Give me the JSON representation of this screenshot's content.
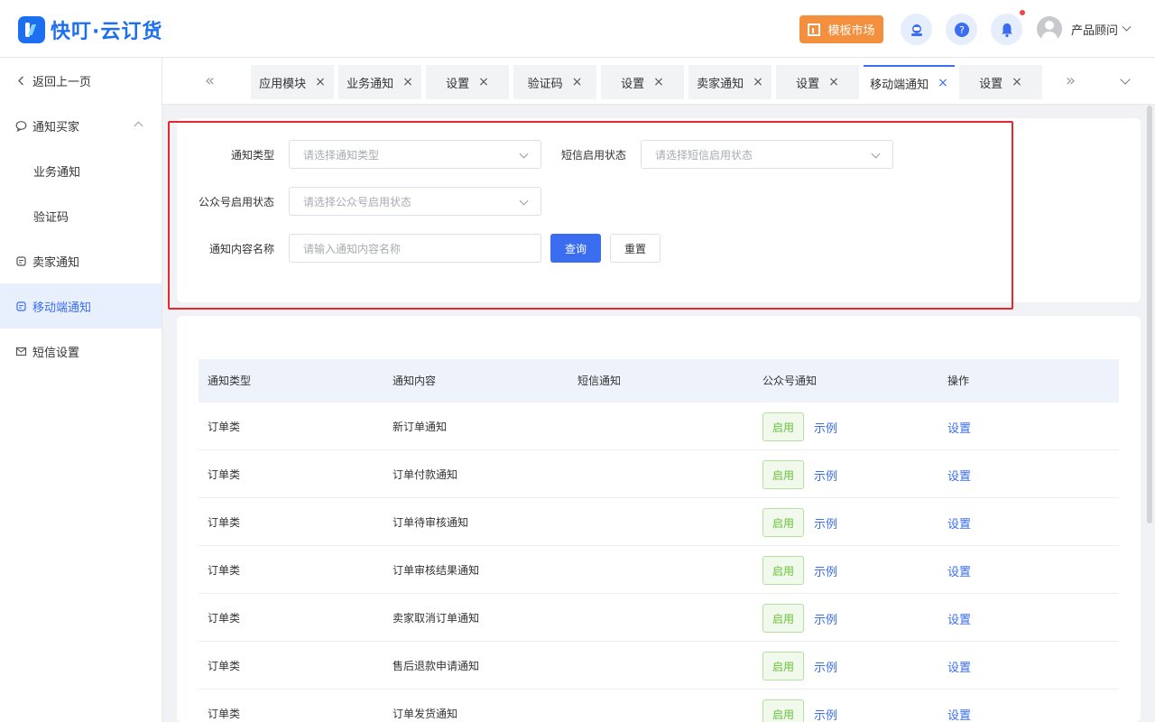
{
  "brand": {
    "name": "快叮·云订货",
    "color": "#1d6ff2"
  },
  "header": {
    "market_label": "模板市场",
    "user_name": "产品顾问"
  },
  "sidebar": {
    "back_label": "返回上一页",
    "items": [
      {
        "label": "通知买家",
        "icon": "chat-icon"
      },
      {
        "label": "业务通知"
      },
      {
        "label": "验证码"
      },
      {
        "label": "卖家通知",
        "icon": "store-icon"
      },
      {
        "label": "移动端通知",
        "icon": "mobile-icon",
        "active": true
      },
      {
        "label": "短信设置",
        "icon": "mail-icon"
      }
    ]
  },
  "tabs": [
    {
      "label": "应用模块"
    },
    {
      "label": "业务通知"
    },
    {
      "label": "设置"
    },
    {
      "label": "验证码"
    },
    {
      "label": "设置"
    },
    {
      "label": "卖家通知"
    },
    {
      "label": "设置"
    },
    {
      "label": "移动端通知",
      "active": true
    },
    {
      "label": "设置"
    }
  ],
  "filters": {
    "type_label": "通知类型",
    "type_placeholder": "请选择通知类型",
    "sms_label": "短信启用状态",
    "sms_placeholder": "请选择短信启用状态",
    "wechat_label": "公众号启用状态",
    "wechat_placeholder": "请选择公众号启用状态",
    "name_label": "通知内容名称",
    "name_placeholder": "请输入通知内容名称",
    "query_label": "查询",
    "reset_label": "重置"
  },
  "table": {
    "columns": [
      "通知类型",
      "通知内容",
      "短信通知",
      "公众号通知",
      "操作"
    ],
    "status_label": "启用",
    "example_label": "示例",
    "action_label": "设置",
    "rows": [
      {
        "type": "订单类",
        "content": "新订单通知"
      },
      {
        "type": "订单类",
        "content": "订单付款通知"
      },
      {
        "type": "订单类",
        "content": "订单待审核通知"
      },
      {
        "type": "订单类",
        "content": "订单审核结果通知"
      },
      {
        "type": "订单类",
        "content": "卖家取消订单通知"
      },
      {
        "type": "订单类",
        "content": "售后退款申请通知"
      },
      {
        "type": "订单类",
        "content": "订单发货通知"
      }
    ]
  },
  "colors": {
    "primary": "#3a6df0",
    "orange": "#f4903d",
    "success": "#67c23a",
    "highlight": "#e8262b"
  }
}
